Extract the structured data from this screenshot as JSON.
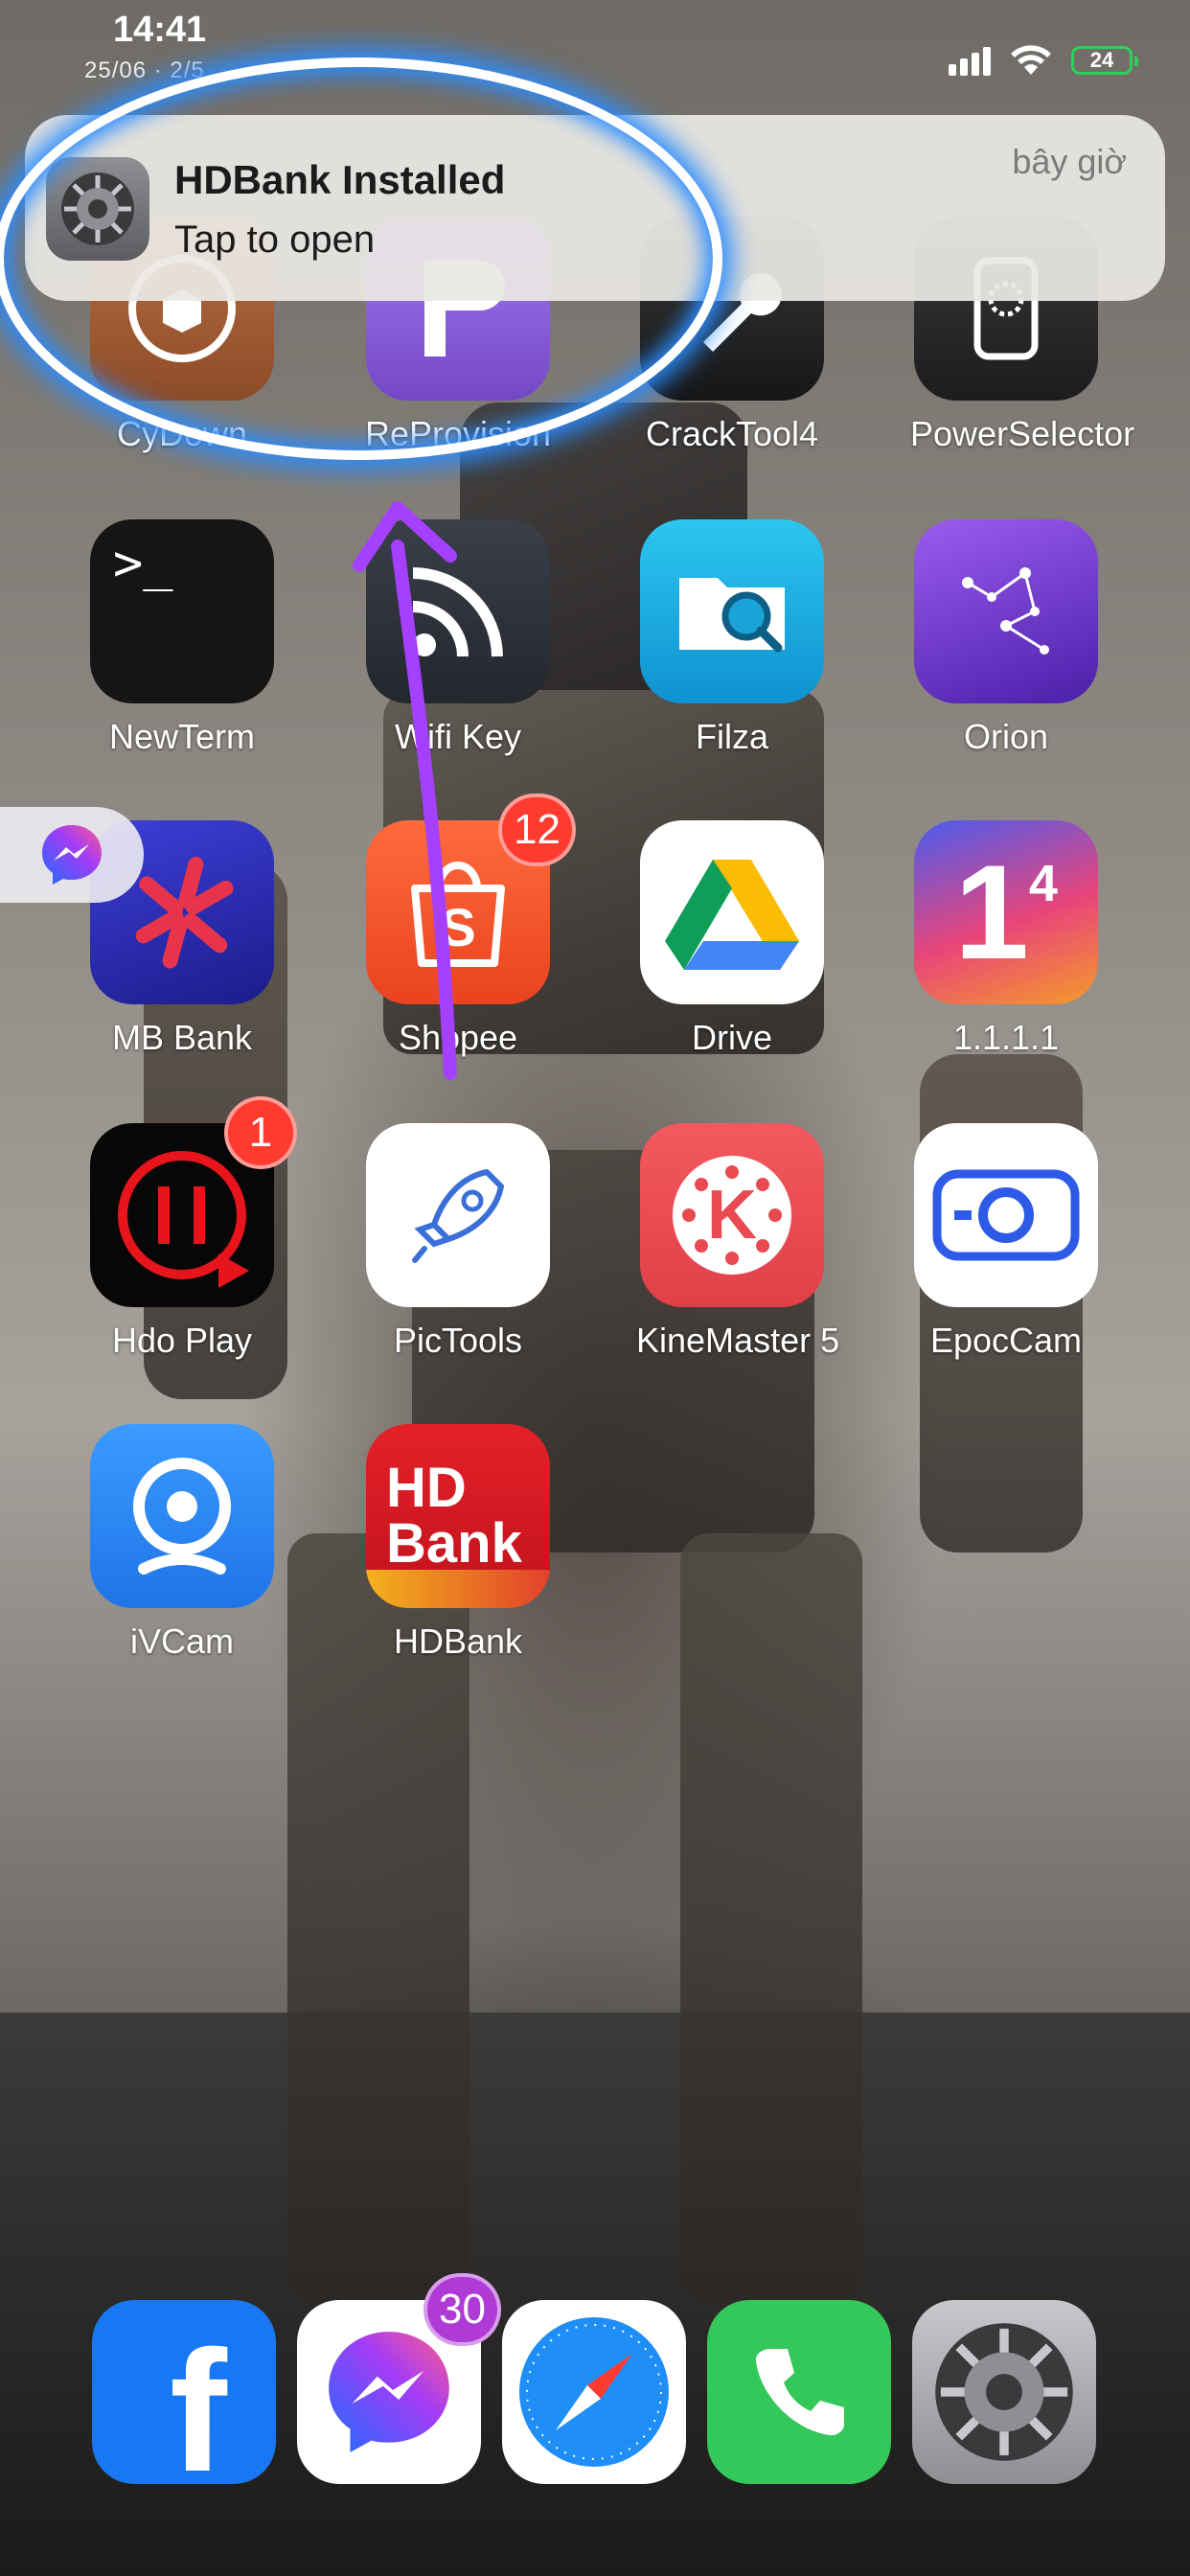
{
  "status_bar": {
    "time": "14:41",
    "date": "25/06 · 2/5",
    "battery": "24",
    "icons": [
      "cellular-signal-icon",
      "wifi-icon",
      "battery-icon"
    ]
  },
  "notification": {
    "title": "HDBank Installed",
    "body": "Tap to open",
    "time": "bây giờ",
    "icon": "settings-gear-icon"
  },
  "home": {
    "rows": [
      [
        {
          "label": "CyDown",
          "color": "#a5623a"
        },
        {
          "label": "ReProvision",
          "color": "#8c62d8"
        },
        {
          "label": "CrackTool4",
          "color": "#2a2a2a"
        },
        {
          "label": "PowerSelector",
          "color": "#2c2c2e"
        }
      ],
      [
        {
          "label": "NewTerm",
          "color": "#1a1a1a"
        },
        {
          "label": "Wifi Key",
          "color": "#2f3440"
        },
        {
          "label": "Filza",
          "color": "#1aa3d9"
        },
        {
          "label": "Orion",
          "color": "#7a3fd6"
        }
      ],
      [
        {
          "label": "MB Bank",
          "color": "#2a2fb8"
        },
        {
          "label": "Shopee",
          "color": "#f2552b",
          "badge": "12"
        },
        {
          "label": "Drive",
          "color": "#ffffff"
        },
        {
          "label": "1.1.1.1",
          "color": "#f07a2a"
        }
      ],
      [
        {
          "label": "Hdo Play",
          "color": "#050505",
          "badge": "1"
        },
        {
          "label": "PicTools",
          "color": "#ffffff"
        },
        {
          "label": "KineMaster 5",
          "color": "#ec4d54"
        },
        {
          "label": "EpocCam",
          "color": "#ffffff"
        }
      ],
      [
        {
          "label": "iVCam",
          "color": "#2b8bf5"
        },
        {
          "label": "HDBank",
          "color": "#d81f26"
        }
      ]
    ],
    "terminal_prompt": ">_",
    "hdbank_logo": "HD Bank",
    "onedotone_logo": "1",
    "onedotone_sup": "4",
    "kinemaster_letter": "K"
  },
  "floating_pill": {
    "icon": "messenger-icon"
  },
  "dock": [
    {
      "name": "facebook",
      "icon": "facebook-icon",
      "color": "#1877f2",
      "glyph": "f"
    },
    {
      "name": "messenger",
      "icon": "messenger-icon",
      "badge": "30"
    },
    {
      "name": "safari",
      "icon": "safari-compass-icon"
    },
    {
      "name": "phone",
      "icon": "phone-icon",
      "color": "#34c759"
    },
    {
      "name": "settings",
      "icon": "settings-gear-icon"
    }
  ],
  "annotation": {
    "ellipse_color": "#2a8cff",
    "arrow_color": "#a640ff"
  }
}
